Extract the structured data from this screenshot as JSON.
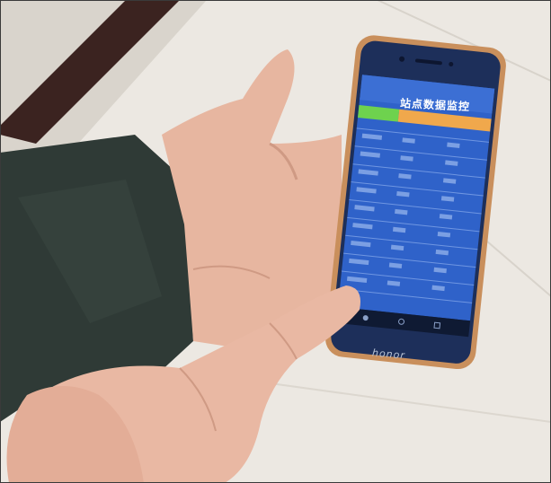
{
  "photo": {
    "app_title": "站点数据监控",
    "brand": "honor"
  },
  "colors": {
    "screen_blue": "#2f62c9",
    "header_green": "#6ed24e",
    "header_orange": "#f0a84c",
    "phone_gold": "#c98f5c",
    "jacket": "#2f3a36",
    "skin": "#e8b7a2"
  }
}
